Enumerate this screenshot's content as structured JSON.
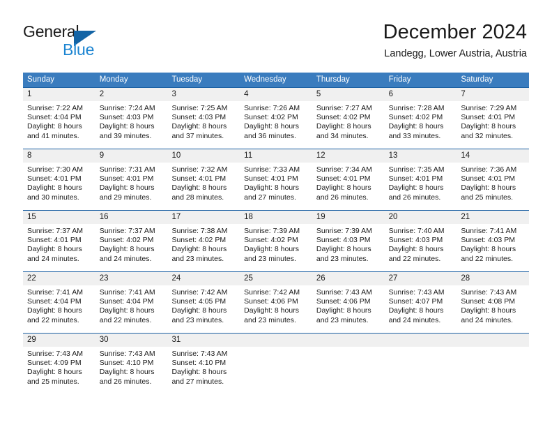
{
  "brand": {
    "name_line1": "General",
    "name_line2": "Blue",
    "mark": "triangle-logo-icon",
    "color_primary": "#1464a5",
    "color_secondary": "#1b84d1"
  },
  "header": {
    "title": "December 2024",
    "subtitle": "Landegg, Lower Austria, Austria"
  },
  "calendar": {
    "header_bg": "#3a7cbe",
    "row_divider": "#1a5fa2",
    "date_band_bg": "#f0f0f0",
    "weekdays": [
      "Sunday",
      "Monday",
      "Tuesday",
      "Wednesday",
      "Thursday",
      "Friday",
      "Saturday"
    ],
    "weeks": [
      [
        {
          "day": "1",
          "sunrise": "Sunrise: 7:22 AM",
          "sunset": "Sunset: 4:04 PM",
          "daylight_line1": "Daylight: 8 hours",
          "daylight_line2": "and 41 minutes."
        },
        {
          "day": "2",
          "sunrise": "Sunrise: 7:24 AM",
          "sunset": "Sunset: 4:03 PM",
          "daylight_line1": "Daylight: 8 hours",
          "daylight_line2": "and 39 minutes."
        },
        {
          "day": "3",
          "sunrise": "Sunrise: 7:25 AM",
          "sunset": "Sunset: 4:03 PM",
          "daylight_line1": "Daylight: 8 hours",
          "daylight_line2": "and 37 minutes."
        },
        {
          "day": "4",
          "sunrise": "Sunrise: 7:26 AM",
          "sunset": "Sunset: 4:02 PM",
          "daylight_line1": "Daylight: 8 hours",
          "daylight_line2": "and 36 minutes."
        },
        {
          "day": "5",
          "sunrise": "Sunrise: 7:27 AM",
          "sunset": "Sunset: 4:02 PM",
          "daylight_line1": "Daylight: 8 hours",
          "daylight_line2": "and 34 minutes."
        },
        {
          "day": "6",
          "sunrise": "Sunrise: 7:28 AM",
          "sunset": "Sunset: 4:02 PM",
          "daylight_line1": "Daylight: 8 hours",
          "daylight_line2": "and 33 minutes."
        },
        {
          "day": "7",
          "sunrise": "Sunrise: 7:29 AM",
          "sunset": "Sunset: 4:01 PM",
          "daylight_line1": "Daylight: 8 hours",
          "daylight_line2": "and 32 minutes."
        }
      ],
      [
        {
          "day": "8",
          "sunrise": "Sunrise: 7:30 AM",
          "sunset": "Sunset: 4:01 PM",
          "daylight_line1": "Daylight: 8 hours",
          "daylight_line2": "and 30 minutes."
        },
        {
          "day": "9",
          "sunrise": "Sunrise: 7:31 AM",
          "sunset": "Sunset: 4:01 PM",
          "daylight_line1": "Daylight: 8 hours",
          "daylight_line2": "and 29 minutes."
        },
        {
          "day": "10",
          "sunrise": "Sunrise: 7:32 AM",
          "sunset": "Sunset: 4:01 PM",
          "daylight_line1": "Daylight: 8 hours",
          "daylight_line2": "and 28 minutes."
        },
        {
          "day": "11",
          "sunrise": "Sunrise: 7:33 AM",
          "sunset": "Sunset: 4:01 PM",
          "daylight_line1": "Daylight: 8 hours",
          "daylight_line2": "and 27 minutes."
        },
        {
          "day": "12",
          "sunrise": "Sunrise: 7:34 AM",
          "sunset": "Sunset: 4:01 PM",
          "daylight_line1": "Daylight: 8 hours",
          "daylight_line2": "and 26 minutes."
        },
        {
          "day": "13",
          "sunrise": "Sunrise: 7:35 AM",
          "sunset": "Sunset: 4:01 PM",
          "daylight_line1": "Daylight: 8 hours",
          "daylight_line2": "and 26 minutes."
        },
        {
          "day": "14",
          "sunrise": "Sunrise: 7:36 AM",
          "sunset": "Sunset: 4:01 PM",
          "daylight_line1": "Daylight: 8 hours",
          "daylight_line2": "and 25 minutes."
        }
      ],
      [
        {
          "day": "15",
          "sunrise": "Sunrise: 7:37 AM",
          "sunset": "Sunset: 4:01 PM",
          "daylight_line1": "Daylight: 8 hours",
          "daylight_line2": "and 24 minutes."
        },
        {
          "day": "16",
          "sunrise": "Sunrise: 7:37 AM",
          "sunset": "Sunset: 4:02 PM",
          "daylight_line1": "Daylight: 8 hours",
          "daylight_line2": "and 24 minutes."
        },
        {
          "day": "17",
          "sunrise": "Sunrise: 7:38 AM",
          "sunset": "Sunset: 4:02 PM",
          "daylight_line1": "Daylight: 8 hours",
          "daylight_line2": "and 23 minutes."
        },
        {
          "day": "18",
          "sunrise": "Sunrise: 7:39 AM",
          "sunset": "Sunset: 4:02 PM",
          "daylight_line1": "Daylight: 8 hours",
          "daylight_line2": "and 23 minutes."
        },
        {
          "day": "19",
          "sunrise": "Sunrise: 7:39 AM",
          "sunset": "Sunset: 4:03 PM",
          "daylight_line1": "Daylight: 8 hours",
          "daylight_line2": "and 23 minutes."
        },
        {
          "day": "20",
          "sunrise": "Sunrise: 7:40 AM",
          "sunset": "Sunset: 4:03 PM",
          "daylight_line1": "Daylight: 8 hours",
          "daylight_line2": "and 22 minutes."
        },
        {
          "day": "21",
          "sunrise": "Sunrise: 7:41 AM",
          "sunset": "Sunset: 4:03 PM",
          "daylight_line1": "Daylight: 8 hours",
          "daylight_line2": "and 22 minutes."
        }
      ],
      [
        {
          "day": "22",
          "sunrise": "Sunrise: 7:41 AM",
          "sunset": "Sunset: 4:04 PM",
          "daylight_line1": "Daylight: 8 hours",
          "daylight_line2": "and 22 minutes."
        },
        {
          "day": "23",
          "sunrise": "Sunrise: 7:41 AM",
          "sunset": "Sunset: 4:04 PM",
          "daylight_line1": "Daylight: 8 hours",
          "daylight_line2": "and 22 minutes."
        },
        {
          "day": "24",
          "sunrise": "Sunrise: 7:42 AM",
          "sunset": "Sunset: 4:05 PM",
          "daylight_line1": "Daylight: 8 hours",
          "daylight_line2": "and 23 minutes."
        },
        {
          "day": "25",
          "sunrise": "Sunrise: 7:42 AM",
          "sunset": "Sunset: 4:06 PM",
          "daylight_line1": "Daylight: 8 hours",
          "daylight_line2": "and 23 minutes."
        },
        {
          "day": "26",
          "sunrise": "Sunrise: 7:43 AM",
          "sunset": "Sunset: 4:06 PM",
          "daylight_line1": "Daylight: 8 hours",
          "daylight_line2": "and 23 minutes."
        },
        {
          "day": "27",
          "sunrise": "Sunrise: 7:43 AM",
          "sunset": "Sunset: 4:07 PM",
          "daylight_line1": "Daylight: 8 hours",
          "daylight_line2": "and 24 minutes."
        },
        {
          "day": "28",
          "sunrise": "Sunrise: 7:43 AM",
          "sunset": "Sunset: 4:08 PM",
          "daylight_line1": "Daylight: 8 hours",
          "daylight_line2": "and 24 minutes."
        }
      ],
      [
        {
          "day": "29",
          "sunrise": "Sunrise: 7:43 AM",
          "sunset": "Sunset: 4:09 PM",
          "daylight_line1": "Daylight: 8 hours",
          "daylight_line2": "and 25 minutes."
        },
        {
          "day": "30",
          "sunrise": "Sunrise: 7:43 AM",
          "sunset": "Sunset: 4:10 PM",
          "daylight_line1": "Daylight: 8 hours",
          "daylight_line2": "and 26 minutes."
        },
        {
          "day": "31",
          "sunrise": "Sunrise: 7:43 AM",
          "sunset": "Sunset: 4:10 PM",
          "daylight_line1": "Daylight: 8 hours",
          "daylight_line2": "and 27 minutes."
        },
        {
          "day": "",
          "sunrise": "",
          "sunset": "",
          "daylight_line1": "",
          "daylight_line2": ""
        },
        {
          "day": "",
          "sunrise": "",
          "sunset": "",
          "daylight_line1": "",
          "daylight_line2": ""
        },
        {
          "day": "",
          "sunrise": "",
          "sunset": "",
          "daylight_line1": "",
          "daylight_line2": ""
        },
        {
          "day": "",
          "sunrise": "",
          "sunset": "",
          "daylight_line1": "",
          "daylight_line2": ""
        }
      ]
    ]
  }
}
